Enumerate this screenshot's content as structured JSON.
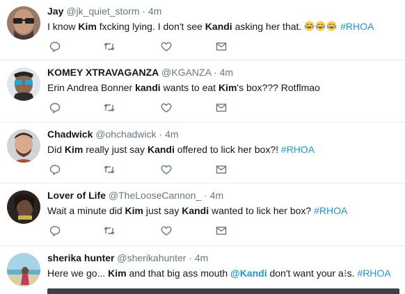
{
  "colors": {
    "name": "#14171a",
    "muted": "#657786",
    "link": "#1b95e0",
    "divider": "#e6ecf0"
  },
  "icons": {
    "reply": "reply-icon",
    "retweet": "retweet-icon",
    "like": "heart-icon",
    "dm": "envelope-icon"
  },
  "tweets": [
    {
      "name": "Jay",
      "handle": "@jk_quiet_storm",
      "dot": "·",
      "time": "4m",
      "t1": "I know ",
      "kw1": "Kim",
      "t2": " fxcking lying. I don't see ",
      "kw2": "Kandi",
      "t3": " asking her that. ",
      "emoji_name": "tears-of-joy-emoji",
      "hashtag": "#RHOA"
    },
    {
      "name": "KOMEY XTRAVAGANZA",
      "handle": "@KGANZA",
      "dot": "·",
      "time": "4m",
      "t1": "Erin Andrea Bonner ",
      "kw1": "kandi",
      "t2": " wants to eat ",
      "kw2": "Kim",
      "t3": "'s box???  Rotflmao"
    },
    {
      "name": "Chadwick",
      "handle": "@ohchadwick",
      "dot": "·",
      "time": "4m",
      "t1": "Did ",
      "kw1": "Kim",
      "t2": " really just say ",
      "kw2": "Kandi",
      "t3": " offered to lick her box?! ",
      "hashtag": "#RHOA"
    },
    {
      "name": "Lover of Life",
      "handle": "@TheLooseCannon_",
      "dot": "·",
      "time": "4m",
      "t1": "Wait a minute did ",
      "kw1": "Kim",
      "t2": " just say ",
      "kw2": "Kandi",
      "t3": " wanted to lick her box? ",
      "hashtag": "#RHOA"
    },
    {
      "name": "sherika hunter",
      "handle": "@sherikahunter",
      "dot": "·",
      "time": "4m",
      "t1": "Here we go... ",
      "kw1": "Kim",
      "t2": " and that big ass mouth ",
      "mention": "@Kandi",
      "t3": " don't want your a",
      "t4": "s. ",
      "hashtag": "#RHOA"
    }
  ]
}
